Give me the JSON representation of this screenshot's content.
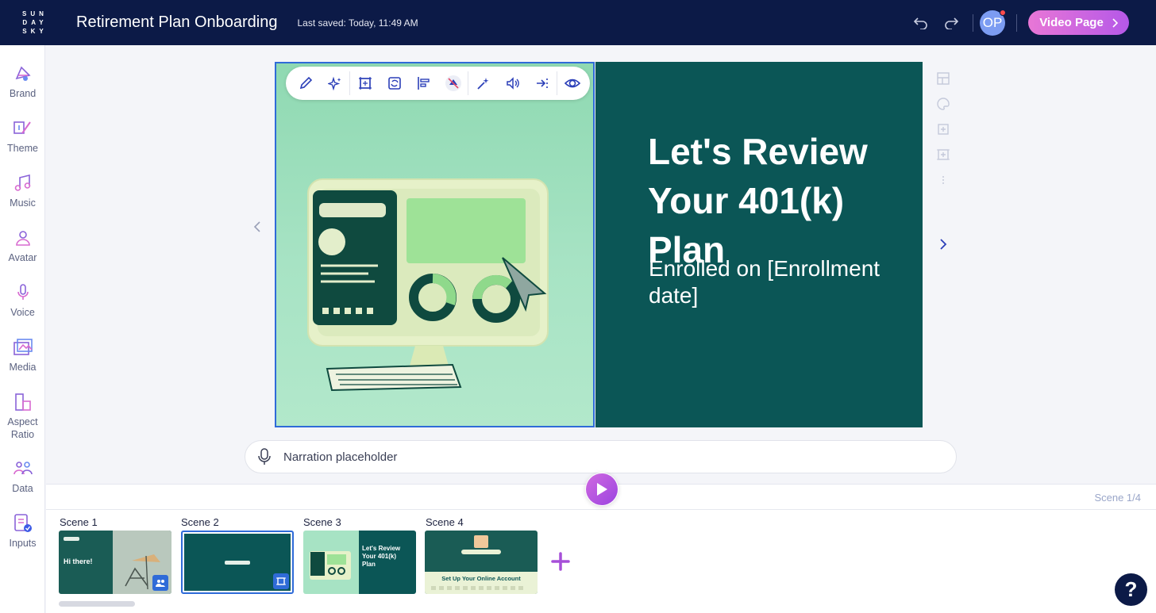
{
  "app": {
    "logo": "SUNDAYSKY",
    "title": "Retirement Plan Onboarding",
    "last_saved": "Last saved: Today, 11:49 AM",
    "user_initials": "OP",
    "video_page_label": "Video Page"
  },
  "sidebar": {
    "items": [
      {
        "label": "Brand",
        "icon": "brand-icon"
      },
      {
        "label": "Theme",
        "icon": "theme-icon"
      },
      {
        "label": "Music",
        "icon": "music-icon"
      },
      {
        "label": "Avatar",
        "icon": "avatar-icon"
      },
      {
        "label": "Voice",
        "icon": "voice-icon"
      },
      {
        "label": "Media",
        "icon": "media-icon"
      },
      {
        "label": "Aspect Ratio",
        "icon": "aspect-ratio-icon"
      },
      {
        "label": "Data",
        "icon": "data-icon"
      },
      {
        "label": "Inputs",
        "icon": "inputs-icon"
      }
    ]
  },
  "scene": {
    "headline": "Let's Review Your 401(k) Plan",
    "subline": "Enrolled on [Enrollment date]"
  },
  "narration": {
    "placeholder": "Narration placeholder"
  },
  "timeline": {
    "scene_count": "Scene 1/4",
    "scenes": [
      {
        "label": "Scene 1",
        "thumb_text": "Hi there!"
      },
      {
        "label": "Scene 2"
      },
      {
        "label": "Scene 3",
        "thumb_text": "Let's Review Your 401(k) Plan"
      },
      {
        "label": "Scene 4",
        "thumb_text": "Set Up Your Online Account"
      }
    ]
  },
  "help": {
    "label": "?"
  },
  "colors": {
    "topbar": "#0c1a47",
    "accent_blue": "#2f6bd8",
    "accent_purple": "#b558e8",
    "scene_teal": "#0b5656",
    "scene_mint": "#a7e3c4"
  }
}
